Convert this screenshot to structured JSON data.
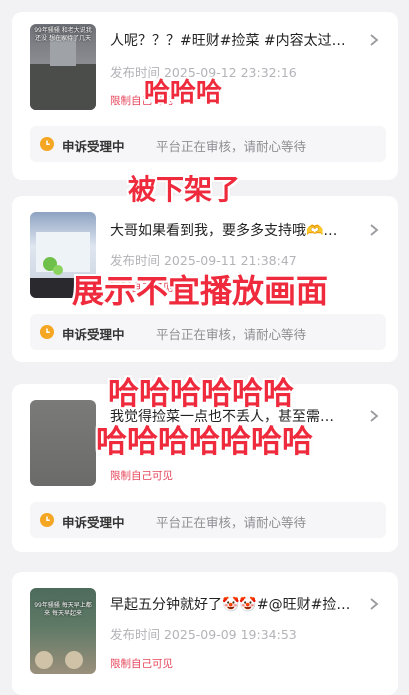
{
  "posts": [
    {
      "title": "人呢？？？#旺财#捡菜 #内容太过…",
      "published": "发布时间  2025-09-12 23:32:16",
      "restriction": "限制自己可见",
      "thumb_caption": "99年骚骚 和老大说我还没 想在家待了几天",
      "status_label": "申诉受理中",
      "status_msg": "平台正在审核，请耐心等待"
    },
    {
      "title": "大哥如果看到我，要多多支持哦🫶…",
      "published": "发布时间  2025-09-11 21:38:47",
      "restriction": "限制自己可见",
      "thumb_caption": "",
      "status_label": "申诉受理中",
      "status_msg": "平台正在审核，请耐心等待"
    },
    {
      "title": "我觉得捡菜一点也不丢人，甚至需…",
      "published": "",
      "restriction": "限制自己可见",
      "thumb_caption": "",
      "status_label": "申诉受理中",
      "status_msg": "平台正在审核，请耐心等待"
    },
    {
      "title": "早起五分钟就好了🤡🤡#@旺财#捡…",
      "published": "发布时间  2025-09-09 19:34:53",
      "restriction": "限制自己可见",
      "thumb_caption": "99年骚骚 每天早上都来 每天早起来",
      "status_label": "",
      "status_msg": ""
    }
  ],
  "overlays": {
    "o1": "哈哈哈",
    "o2": "被下架了",
    "o3": "展示不宜播放画面",
    "o4": "哈哈哈哈哈哈",
    "o5": "哈哈哈哈哈哈哈"
  },
  "icons": {
    "chevron": "chevron-right-icon",
    "clock": "clock-icon"
  },
  "colors": {
    "accent_orange": "#f5a623",
    "restrict_red": "#e5455a",
    "overlay_red": "#ee2a3c"
  }
}
